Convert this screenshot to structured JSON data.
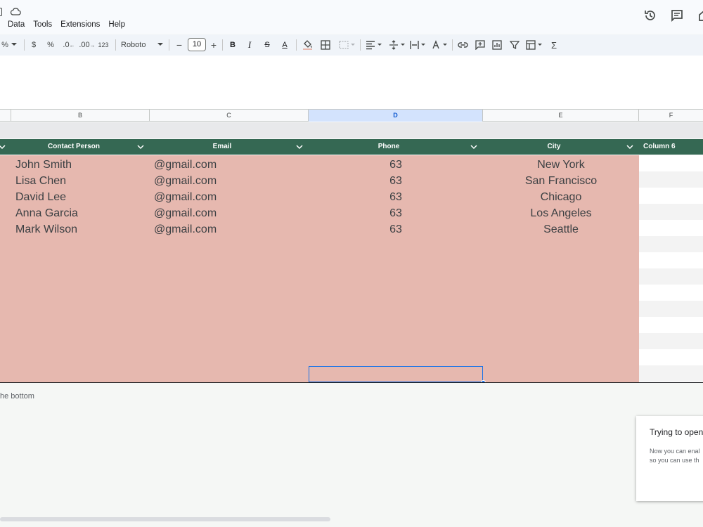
{
  "menu": [
    "Data",
    "Tools",
    "Extensions",
    "Help"
  ],
  "toolbar": {
    "percent": "%",
    "currency": "$",
    "percent2": "%",
    "dec_decrease": ".0",
    "dec_increase": ".00",
    "number_format": "123",
    "font": "Roboto",
    "font_size": "10",
    "bold": "B",
    "italic": "I",
    "strike": "S",
    "text_color": "A",
    "sigma": "Σ"
  },
  "columns": [
    {
      "label": "B"
    },
    {
      "label": "C"
    },
    {
      "label": "D"
    },
    {
      "label": "E"
    },
    {
      "label": "F"
    }
  ],
  "headers": [
    "Contact Person",
    "Email",
    "Phone",
    "City",
    "Column 6"
  ],
  "rows": [
    {
      "contact": "John Smith",
      "email": "@gmail.com",
      "phone": "63",
      "city": "New York"
    },
    {
      "contact": "Lisa Chen",
      "email": "@gmail.com",
      "phone": "63",
      "city": "San Francisco"
    },
    {
      "contact": "David Lee",
      "email": "@gmail.com",
      "phone": "63",
      "city": "Chicago"
    },
    {
      "contact": "Anna Garcia",
      "email": "@gmail.com",
      "phone": "63",
      "city": "Los Angeles"
    },
    {
      "contact": "Mark Wilson",
      "email": "@gmail.com",
      "phone": "63",
      "city": "Seattle"
    }
  ],
  "bottom_text": "he bottom",
  "dialog": {
    "title": "Trying to open",
    "line1": "Now you can enal",
    "line2": "so you can use th"
  },
  "colors": {
    "header_green": "#356853",
    "row_fill": "#e6b8af",
    "selection_blue": "#1a73e8"
  }
}
